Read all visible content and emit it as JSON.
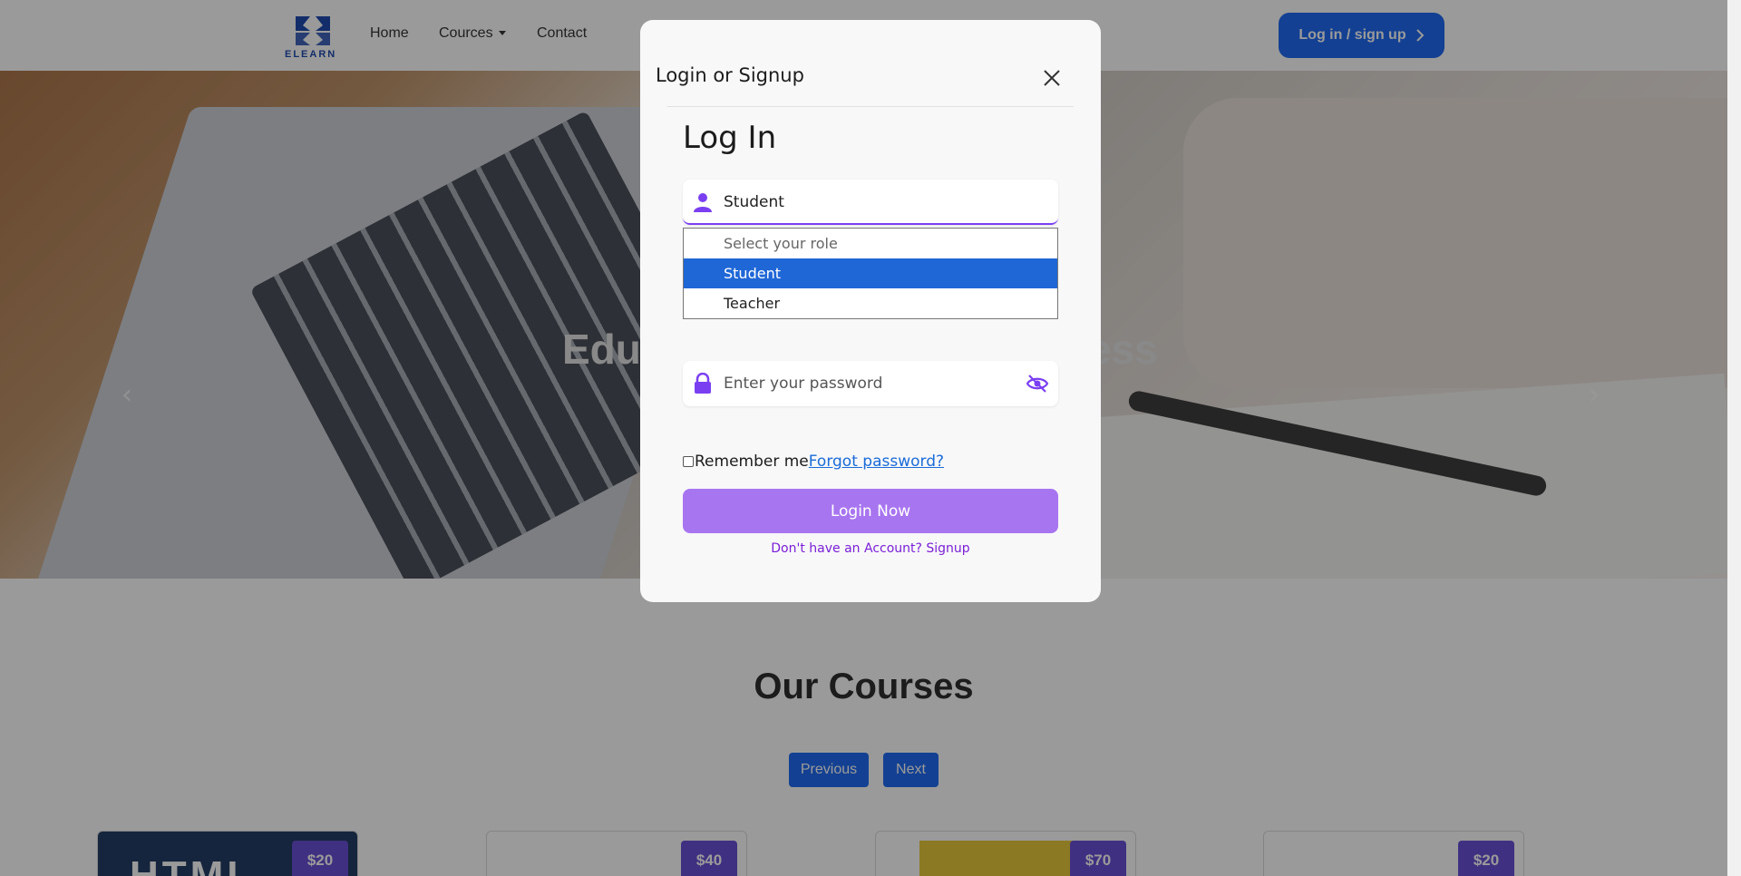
{
  "navbar": {
    "logo_text": "ELEARN",
    "links": [
      "Home",
      "Cources",
      "Contact"
    ],
    "login_button": "Log in / sign up"
  },
  "hero": {
    "headline_left": "Edu",
    "headline_right": "ess"
  },
  "courses": {
    "title": "Our Courses",
    "prev_label": "Previous",
    "next_label": "Next",
    "cards": [
      {
        "price": "$20",
        "banner": "HTML"
      },
      {
        "price": "$40"
      },
      {
        "price": "$70"
      },
      {
        "price": "$20"
      }
    ]
  },
  "modal": {
    "title": "Login or Signup",
    "heading": "Log In",
    "role_value": "Student",
    "role_options": [
      "Select your role",
      "Student",
      "Teacher"
    ],
    "selected_option_index": 1,
    "password_placeholder": "Enter your password",
    "remember_label": "Remember me",
    "forgot_label": "Forgot password?",
    "login_button": "Login Now",
    "signup_text": "Don't have an Account? Signup"
  },
  "colors": {
    "brand_blue": "#0a5cf0",
    "accent_purple": "#7b3ff2",
    "login_button": "#a875f0",
    "option_highlight": "#1f67d6",
    "price_badge": "#5b3fd1"
  },
  "icons": {
    "role_field": "user-icon",
    "password_field": "lock-icon",
    "password_toggle": "eye-slash-icon",
    "close": "close-icon"
  }
}
